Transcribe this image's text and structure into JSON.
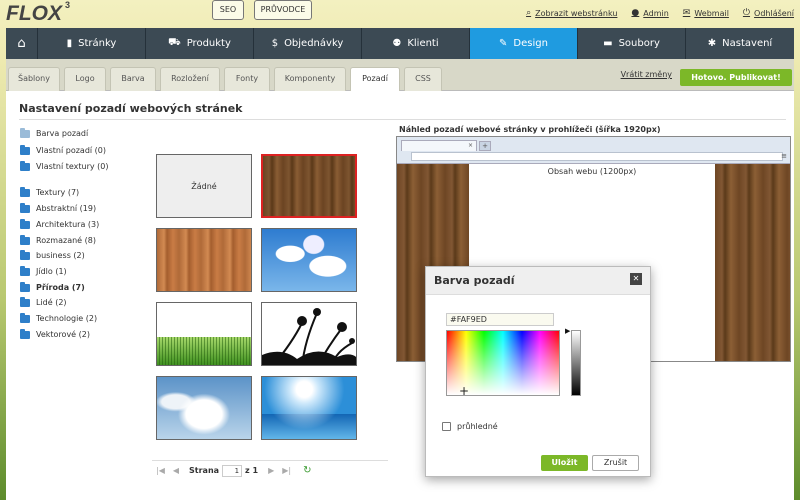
{
  "header": {
    "logo": "FLOX",
    "logo_version": "3",
    "seo_button": "SEO",
    "guide_button": "PRŮVODCE",
    "links": [
      {
        "label": "Zobrazit webstránku",
        "icon": "search-icon",
        "glyph": "⌕"
      },
      {
        "label": "Admin",
        "icon": "user-icon",
        "glyph": "●"
      },
      {
        "label": "Webmail",
        "icon": "envelope-icon",
        "glyph": "✉"
      },
      {
        "label": "Odhlášení",
        "icon": "power-icon",
        "glyph": "⏻"
      }
    ]
  },
  "nav": {
    "home_icon": "home-icon",
    "home_glyph": "⌂",
    "items": [
      {
        "label": "Stránky",
        "icon": "file-icon",
        "glyph": "▮"
      },
      {
        "label": "Produkty",
        "icon": "cart-icon",
        "glyph": "⛟"
      },
      {
        "label": "Objednávky",
        "icon": "dollar-icon",
        "glyph": "$"
      },
      {
        "label": "Klienti",
        "icon": "users-icon",
        "glyph": "⚉"
      },
      {
        "label": "Design",
        "icon": "brush-icon",
        "glyph": "✎"
      },
      {
        "label": "Soubory",
        "icon": "folder-icon",
        "glyph": "▬"
      },
      {
        "label": "Nastavení",
        "icon": "gear-icon",
        "glyph": "✱"
      }
    ],
    "active": "Design",
    "active_color": "#1f9be0",
    "bar_color": "#3c4a54"
  },
  "tabs": {
    "items": [
      "Šablony",
      "Logo",
      "Barva",
      "Rozložení",
      "Fonty",
      "Komponenty",
      "Pozadí",
      "CSS"
    ],
    "active": "Pozadí",
    "undo_link": "Vrátit změny",
    "publish_button": "Hotovo. Publikovat!",
    "accent_color": "#7cb828"
  },
  "page": {
    "title": "Nastavení pozadí webových stránek"
  },
  "categories": {
    "root": "Barva pozadí",
    "items": [
      {
        "label": "Vlastní pozadí (0)",
        "bold": false
      },
      {
        "label": "Vlastní textury (0)",
        "bold": false
      },
      {
        "label": "Textury (7)",
        "bold": false
      },
      {
        "label": "Abstraktní (19)",
        "bold": false
      },
      {
        "label": "Architektura (3)",
        "bold": false
      },
      {
        "label": "Rozmazané (8)",
        "bold": false
      },
      {
        "label": "business (2)",
        "bold": false
      },
      {
        "label": "Jídlo (1)",
        "bold": false
      },
      {
        "label": "Příroda (7)",
        "bold": true
      },
      {
        "label": "Lidé (2)",
        "bold": false
      },
      {
        "label": "Technologie (2)",
        "bold": false
      },
      {
        "label": "Vektorové (2)",
        "bold": false
      }
    ]
  },
  "thumbnails": {
    "none_label": "Žádné",
    "items": [
      "none",
      "dark-wood",
      "light-wood",
      "blue-sky-clouds",
      "green-grass",
      "flower-silhouette",
      "cloudy-sky",
      "sun-over-sea"
    ],
    "selected": "dark-wood"
  },
  "pager": {
    "label": "Strana",
    "current": "1",
    "of_label": "z 1"
  },
  "preview": {
    "label": "Náhled pozadí webové stránky v prohlížeči (šířka 1920px)",
    "content_label": "Obsah webu (1200px)",
    "tab_close": "×",
    "new_tab": "+",
    "menu_glyph": "≡"
  },
  "color_dialog": {
    "title": "Barva pozadí",
    "close_glyph": "✕",
    "hex_value": "#FAF9ED",
    "transparent_label": "průhledné",
    "save_button": "Uložit",
    "cancel_button": "Zrušit"
  }
}
